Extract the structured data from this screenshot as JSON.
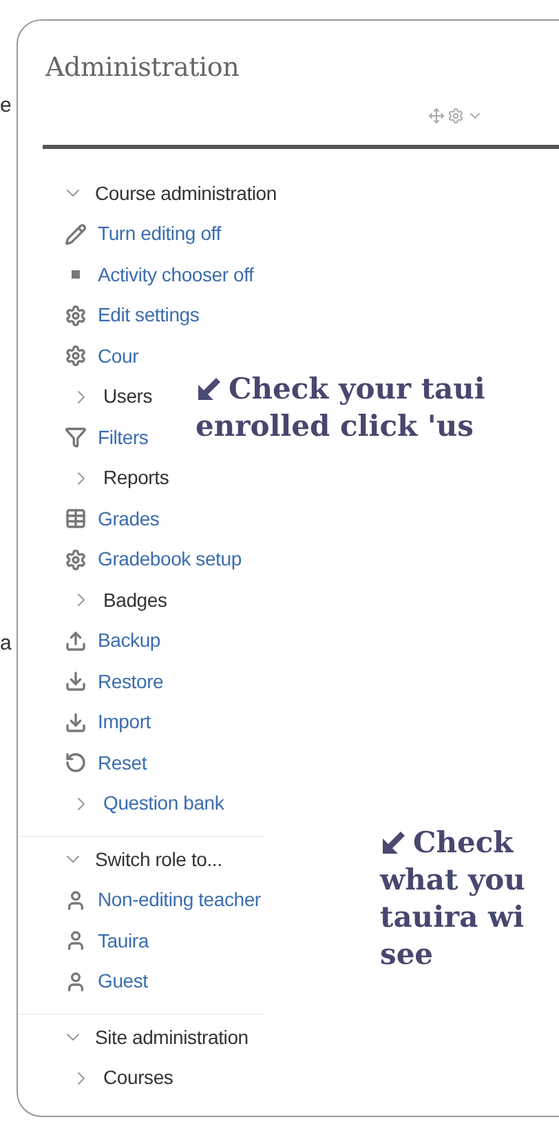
{
  "outside_fragments": [
    "e",
    "a"
  ],
  "block": {
    "title": "Administration",
    "groups": [
      {
        "label": "Course administration",
        "expanded": true,
        "children": [
          {
            "kind": "edit",
            "label": "Turn editing off"
          },
          {
            "kind": "bullet",
            "label": "Activity chooser off"
          },
          {
            "kind": "settings",
            "label": "Edit settings"
          },
          {
            "kind": "settings",
            "label": "Cour"
          },
          {
            "kind": "node",
            "label": "Users",
            "expanded": false
          },
          {
            "kind": "filter",
            "label": "Filters"
          },
          {
            "kind": "node",
            "label": "Reports",
            "expanded": false
          },
          {
            "kind": "grades",
            "label": "Grades"
          },
          {
            "kind": "settings",
            "label": "Gradebook setup"
          },
          {
            "kind": "node",
            "label": "Badges",
            "expanded": false
          },
          {
            "kind": "backup",
            "label": "Backup"
          },
          {
            "kind": "restore",
            "label": "Restore"
          },
          {
            "kind": "restore",
            "label": "Import"
          },
          {
            "kind": "reset",
            "label": "Reset"
          },
          {
            "kind": "link-node",
            "label": "Question bank",
            "expanded": false
          }
        ]
      },
      {
        "label": "Switch role to...",
        "expanded": true,
        "children": [
          {
            "kind": "user",
            "label": "Non-editing teacher"
          },
          {
            "kind": "user",
            "label": "Tauira"
          },
          {
            "kind": "user",
            "label": "Guest"
          }
        ]
      },
      {
        "label": "Site administration",
        "expanded": true,
        "children": [
          {
            "kind": "node",
            "label": "Courses",
            "expanded": false
          }
        ]
      }
    ]
  },
  "annotations": [
    {
      "lines": [
        "Check your taui",
        "enrolled click 'us"
      ]
    },
    {
      "lines": [
        "Check",
        "what you",
        "tauira wi",
        "see"
      ]
    }
  ]
}
